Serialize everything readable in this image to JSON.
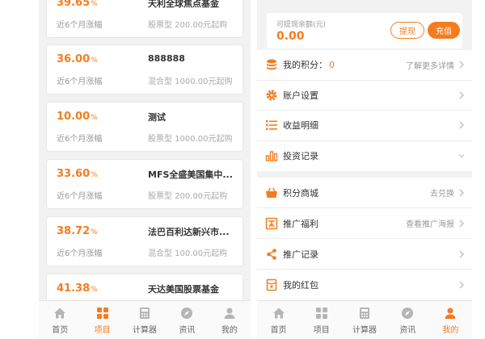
{
  "fund_list": {
    "items": [
      {
        "rate": "39.65",
        "rate_unit": "%",
        "rate_label": "近6个月涨幅",
        "name": "天利全球焦点基金",
        "meta": "股票型 200.00元起购"
      },
      {
        "rate": "36.00",
        "rate_unit": "%",
        "rate_label": "近6个月涨幅",
        "name": "888888",
        "meta": "混合型 1000.00元起购"
      },
      {
        "rate": "10.00",
        "rate_unit": "%",
        "rate_label": "近6个月涨幅",
        "name": "测试",
        "meta": "股票型 1000.00元起购"
      },
      {
        "rate": "33.60",
        "rate_unit": "%",
        "rate_label": "近6个月涨幅",
        "name": "MFS全盛美国集中...",
        "meta": "股票型 200.00元起购"
      },
      {
        "rate": "38.72",
        "rate_unit": "%",
        "rate_label": "近6个月涨幅",
        "name": "法巴百利达新兴市...",
        "meta": "混合型 100.00元起购"
      },
      {
        "rate": "41.38",
        "rate_unit": "%",
        "rate_label": "",
        "name": "天达美国股票基金",
        "meta": ""
      }
    ]
  },
  "left_tabbar": {
    "tabs": [
      {
        "label": "首页",
        "icon": "home-icon"
      },
      {
        "label": "项目",
        "icon": "grid-icon"
      },
      {
        "label": "计算器",
        "icon": "calculator-icon"
      },
      {
        "label": "资讯",
        "icon": "compass-icon"
      },
      {
        "label": "我的",
        "icon": "user-icon"
      }
    ],
    "active": "项目"
  },
  "account": {
    "balance_label": "可提现余额(元)",
    "balance_amount": "0.00",
    "withdraw_label": "提现",
    "topup_label": "充值",
    "points_label": "我的积分：",
    "points_value": "0",
    "points_detail": "了解更多详情",
    "menu1": [
      {
        "label": "账户设置",
        "icon": "gear-icon"
      },
      {
        "label": "收益明细",
        "icon": "list-icon"
      },
      {
        "label": "投资记录",
        "icon": "bar-chart-icon"
      }
    ],
    "menu2": [
      {
        "label": "积分商城",
        "right": "去兑换",
        "icon": "basket-icon"
      },
      {
        "label": "推广福利",
        "right": "查看推广海报",
        "icon": "gift-icon"
      },
      {
        "label": "推广记录",
        "right": "",
        "icon": "share-icon"
      },
      {
        "label": "我的红包",
        "right": "",
        "icon": "red-packet-icon"
      }
    ]
  },
  "right_tabbar": {
    "tabs": [
      {
        "label": "首页",
        "icon": "home-icon"
      },
      {
        "label": "项目",
        "icon": "grid-icon"
      },
      {
        "label": "计算器",
        "icon": "calculator-icon"
      },
      {
        "label": "资讯",
        "icon": "compass-icon"
      },
      {
        "label": "我的",
        "icon": "user-icon"
      }
    ],
    "active": "我的"
  },
  "colors": {
    "accent": "#f47c20",
    "muted": "#999999",
    "text": "#333333",
    "inactive_icon": "#b5b5b5"
  }
}
